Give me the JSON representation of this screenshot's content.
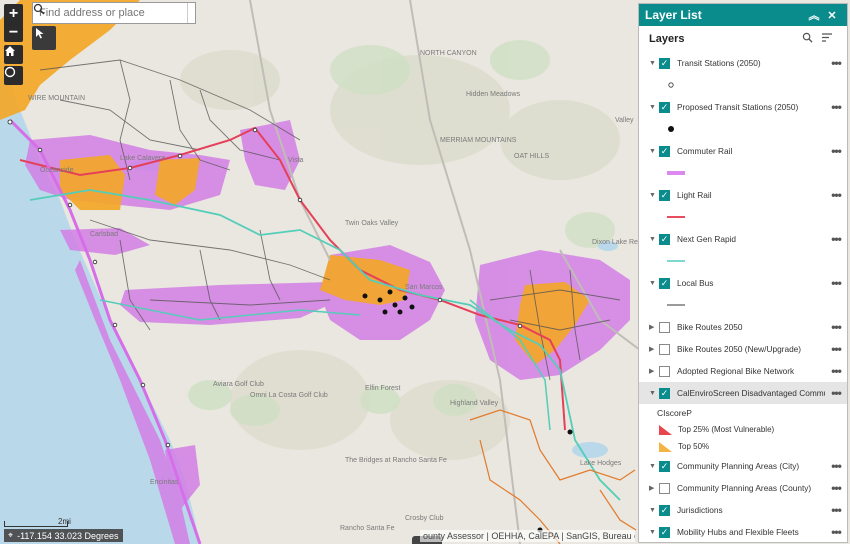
{
  "search": {
    "placeholder": "Find address or place"
  },
  "controls": {
    "zoom_in": "+",
    "zoom_out": "−"
  },
  "map_labels": [
    "WIRE MOUNTAIN",
    "Oceanside",
    "Carlsbad",
    "Lake Calavera",
    "Vista",
    "San Marcos",
    "MERRIAM MOUNTAINS",
    "OAT HILLS",
    "Hidden Meadows",
    "Aviara Golf Club",
    "Omni La Costa Golf Club",
    "The Bridges at Rancho Santa Fe",
    "Encinitas",
    "Crosby Club",
    "Rancho Santa Fe",
    "Elfin Forest",
    "Highland Valley",
    "Dixon Lake Recreation Area",
    "Lake Hodges",
    "Valley",
    "Twin Oaks Valley",
    "NORTH CANYON"
  ],
  "scale": {
    "label": "2mi"
  },
  "coordinates": {
    "text": "-117.154 33.023 Degrees"
  },
  "attribution": "ounty Assessor | OEHHA, CalEPA | SanGIS, Bureau of Land",
  "panel": {
    "title": "Layer List",
    "section_label": "Layers",
    "layers": [
      {
        "name": "Transit Stations (2050)",
        "checked": true,
        "expanded": true,
        "legend": "hollow-dot"
      },
      {
        "name": "Proposed Transit Stations (2050)",
        "checked": true,
        "expanded": true,
        "legend": "black-dot"
      },
      {
        "name": "Commuter Rail",
        "checked": true,
        "expanded": true,
        "legend": "line",
        "color": "#dd88ee"
      },
      {
        "name": "Light Rail",
        "checked": true,
        "expanded": true,
        "legend": "line",
        "color": "#e84c5e"
      },
      {
        "name": "Next Gen Rapid",
        "checked": true,
        "expanded": true,
        "legend": "line",
        "color": "#7fd8cf"
      },
      {
        "name": "Local Bus",
        "checked": true,
        "expanded": true,
        "legend": "line",
        "color": "#9a9a9a"
      },
      {
        "name": "Bike Routes 2050",
        "checked": false,
        "expanded": false
      },
      {
        "name": "Bike Routes 2050 (New/Upgrade)",
        "checked": false,
        "expanded": false
      },
      {
        "name": "Adopted Regional Bike Network",
        "checked": false,
        "expanded": false
      },
      {
        "name": "CalEnviroScreen Disadvantaged Communities",
        "checked": true,
        "expanded": true,
        "highlighted": true
      }
    ],
    "ces_field": "CIscoreP",
    "ces_classes": [
      {
        "label": "Top 25% (Most Vulnerable)",
        "color": "#e8464f"
      },
      {
        "label": "Top 50%",
        "color": "#f4b342"
      }
    ],
    "layers_after": [
      {
        "name": "Community Planning Areas (City)",
        "checked": true
      },
      {
        "name": "Community Planning Areas (County)",
        "checked": false
      },
      {
        "name": "Jurisdictions",
        "checked": true
      },
      {
        "name": "Mobility Hubs and Flexible Fleets",
        "checked": true
      }
    ]
  }
}
